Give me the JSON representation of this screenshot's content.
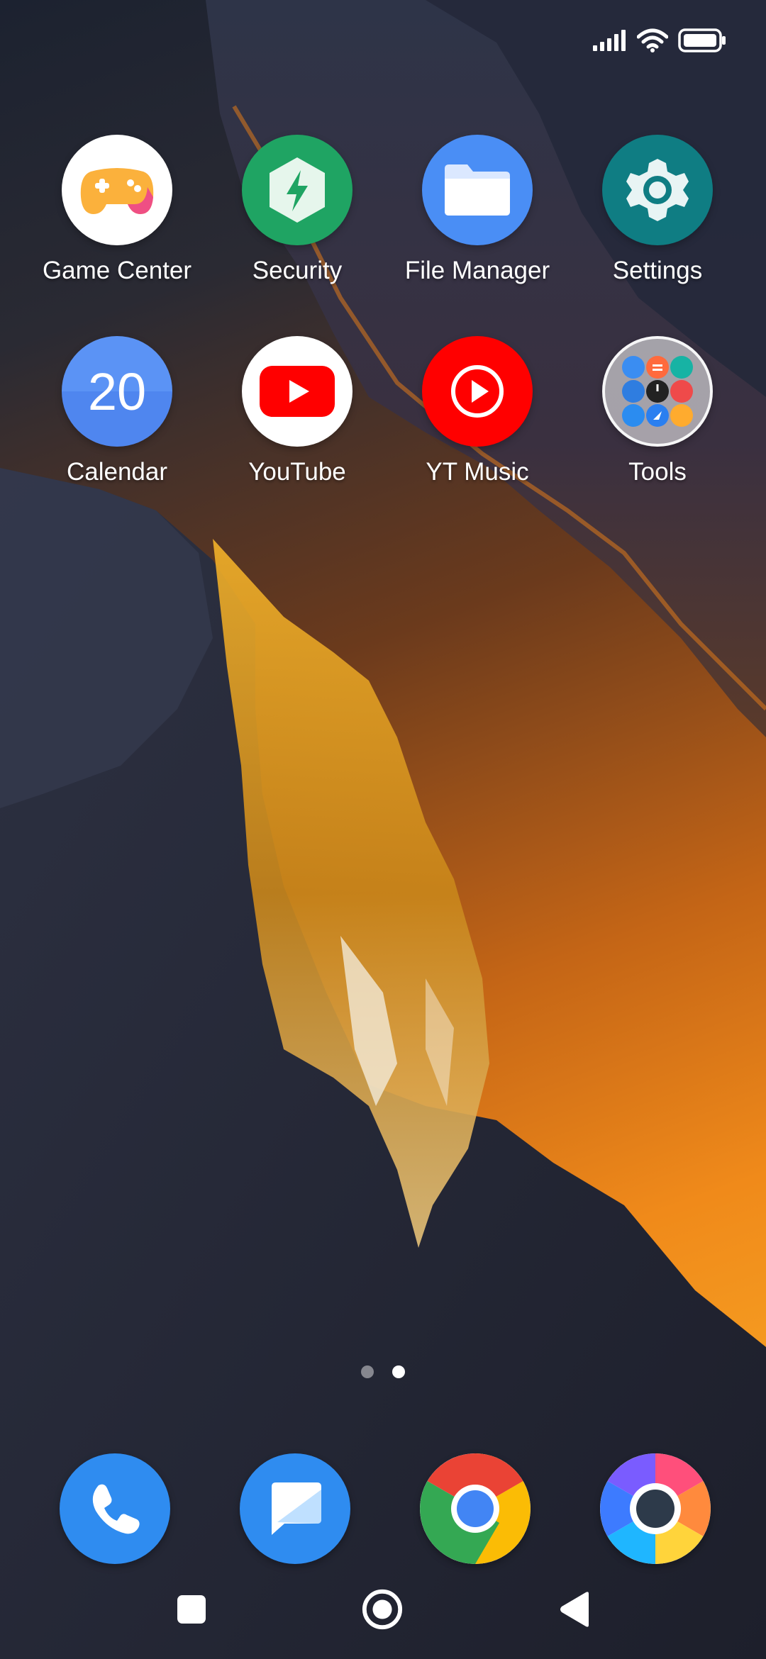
{
  "status_bar": {
    "signal_icon": "cellular-signal-icon",
    "wifi_icon": "wifi-icon",
    "battery_icon": "battery-icon"
  },
  "apps": [
    {
      "label": "Game Center",
      "icon": "game-controller-icon"
    },
    {
      "label": "Security",
      "icon": "security-bolt-icon"
    },
    {
      "label": "File Manager",
      "icon": "folder-icon"
    },
    {
      "label": "Settings",
      "icon": "gear-icon"
    },
    {
      "label": "Calendar",
      "icon": "calendar-icon",
      "day": "20"
    },
    {
      "label": "YouTube",
      "icon": "youtube-icon"
    },
    {
      "label": "YT Music",
      "icon": "yt-music-icon"
    },
    {
      "label": "Tools",
      "icon": "tools-folder-icon"
    }
  ],
  "page_indicator": {
    "pages": 2,
    "current": 2
  },
  "dock": [
    {
      "icon": "phone-icon"
    },
    {
      "icon": "messages-icon"
    },
    {
      "icon": "chrome-icon"
    },
    {
      "icon": "browser-icon"
    }
  ],
  "nav_bar": {
    "recents_icon": "recents-square-icon",
    "home_icon": "home-circle-icon",
    "back_icon": "back-triangle-icon"
  },
  "colors": {
    "game_center": "#ffffff",
    "security": "#1fa463",
    "file_manager": "#4a8ef5",
    "settings": "#0f7d83",
    "calendar": "#5b93f5",
    "youtube_red": "#ff0000",
    "phone": "#2f8cf0",
    "messages": "#2f8cf0"
  }
}
